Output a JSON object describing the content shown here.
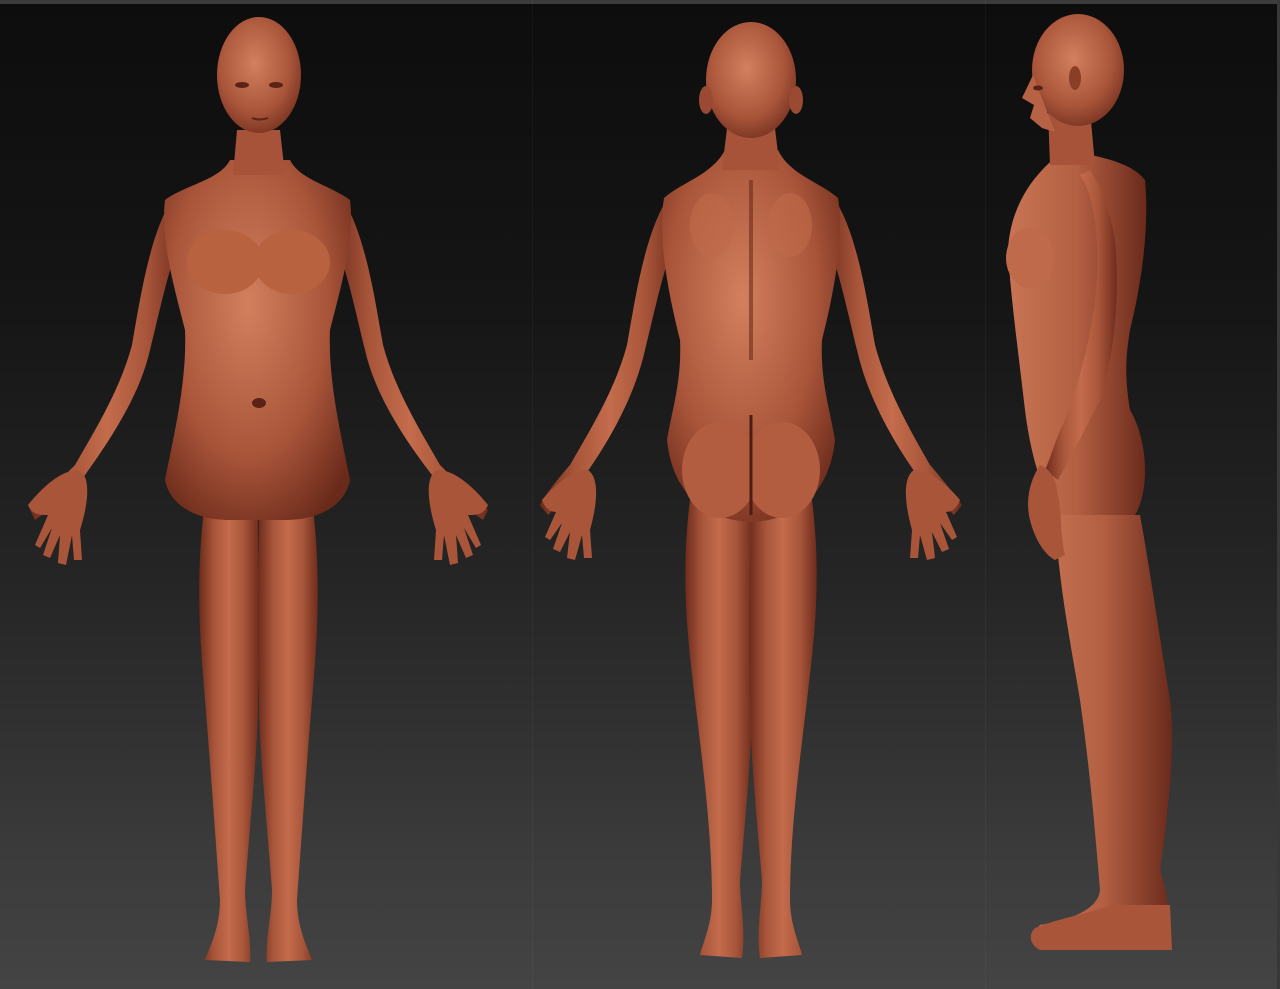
{
  "scene": {
    "background_top": "#0d0d0d",
    "background_bottom": "#444444",
    "skin_base": "#b25b3e",
    "skin_highlight": "#d98868",
    "skin_shadow": "#5e2618"
  },
  "views": [
    {
      "name": "front-view"
    },
    {
      "name": "back-view"
    },
    {
      "name": "side-view"
    }
  ]
}
